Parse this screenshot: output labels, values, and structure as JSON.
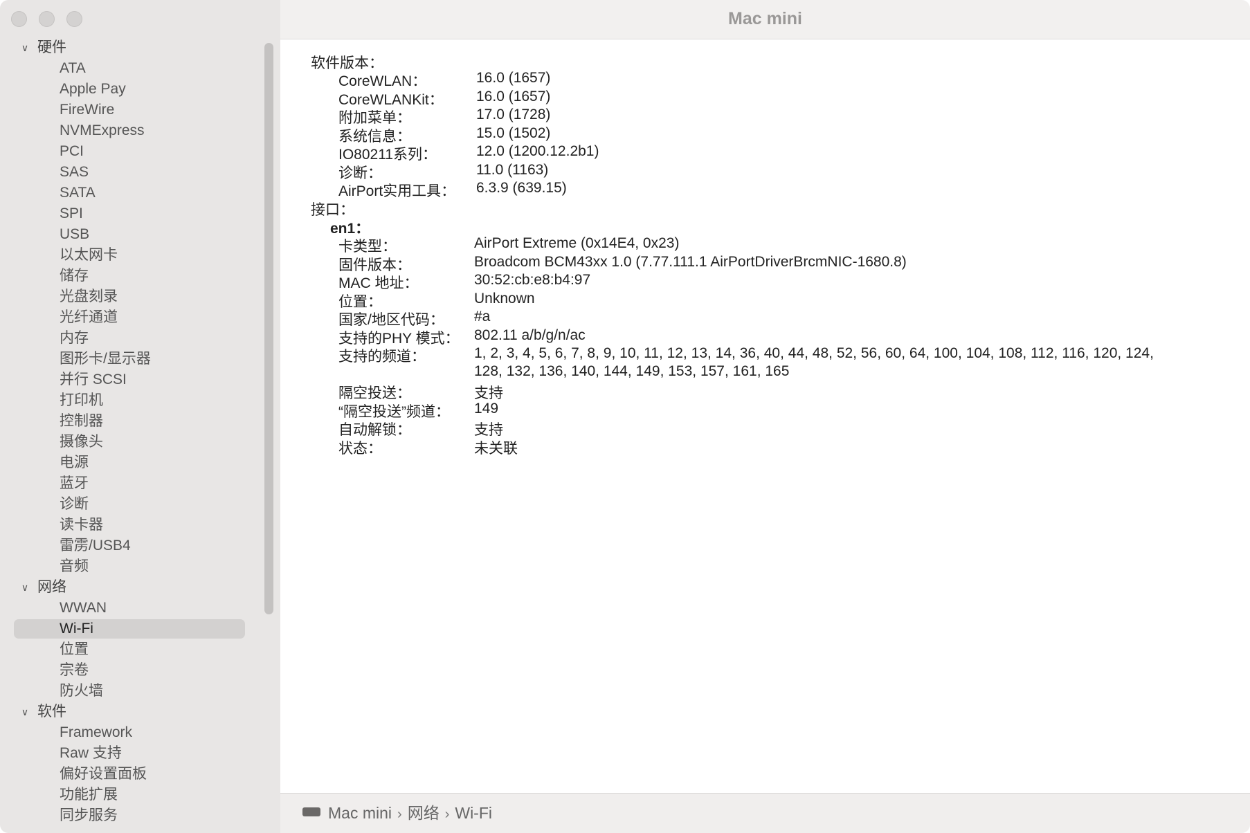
{
  "window": {
    "title": "Mac mini"
  },
  "sidebar": {
    "groups": [
      {
        "label": "硬件",
        "items": [
          "ATA",
          "Apple Pay",
          "FireWire",
          "NVMExpress",
          "PCI",
          "SAS",
          "SATA",
          "SPI",
          "USB",
          "以太网卡",
          "储存",
          "光盘刻录",
          "光纤通道",
          "内存",
          "图形卡/显示器",
          "并行 SCSI",
          "打印机",
          "控制器",
          "摄像头",
          "电源",
          "蓝牙",
          "诊断",
          "读卡器",
          "雷雳/USB4",
          "音频"
        ]
      },
      {
        "label": "网络",
        "items": [
          "WWAN",
          "Wi-Fi",
          "位置",
          "宗卷",
          "防火墙"
        ]
      },
      {
        "label": "软件",
        "items": [
          "Framework",
          "Raw 支持",
          "偏好设置面板",
          "功能扩展",
          "同步服务"
        ]
      }
    ],
    "selected": "Wi-Fi"
  },
  "content": {
    "software_versions_title": "软件版本：",
    "software_versions": [
      {
        "key": "CoreWLAN：",
        "value": "16.0 (1657)"
      },
      {
        "key": "CoreWLANKit：",
        "value": "16.0 (1657)"
      },
      {
        "key": "附加菜单：",
        "value": "17.0 (1728)"
      },
      {
        "key": "系统信息：",
        "value": "15.0 (1502)"
      },
      {
        "key": "IO80211系列：",
        "value": "12.0 (1200.12.2b1)"
      },
      {
        "key": "诊断：",
        "value": "11.0 (1163)"
      },
      {
        "key": "AirPort实用工具：",
        "value": "6.3.9 (639.15)"
      }
    ],
    "interfaces_title": "接口：",
    "interface_name": "en1：",
    "interface_props": [
      {
        "key": "卡类型：",
        "value": "AirPort Extreme  (0x14E4, 0x23)"
      },
      {
        "key": "固件版本：",
        "value": "Broadcom BCM43xx 1.0 (7.77.111.1 AirPortDriverBrcmNIC-1680.8)"
      },
      {
        "key": "MAC 地址：",
        "value": "30:52:cb:e8:b4:97"
      },
      {
        "key": "位置：",
        "value": "Unknown"
      },
      {
        "key": "国家/地区代码：",
        "value": "#a"
      },
      {
        "key": "支持的PHY 模式：",
        "value": "802.11 a/b/g/n/ac"
      },
      {
        "key": "支持的频道：",
        "value": "1, 2, 3, 4, 5, 6, 7, 8, 9, 10, 11, 12, 13, 14, 36, 40, 44, 48, 52, 56, 60, 64, 100, 104, 108, 112, 116, 120, 124,",
        "value2": "128, 132, 136, 140, 144, 149, 153, 157, 161, 165"
      },
      {
        "key": "隔空投送：",
        "value": "支持"
      },
      {
        "key": "“隔空投送”频道：",
        "value": "149"
      },
      {
        "key": "自动解锁：",
        "value": "支持"
      },
      {
        "key": "状态：",
        "value": "未关联"
      }
    ]
  },
  "pathbar": {
    "icon": "mac-mini-icon",
    "crumbs": [
      "Mac mini",
      "网络",
      "Wi-Fi"
    ],
    "separator": "›"
  }
}
